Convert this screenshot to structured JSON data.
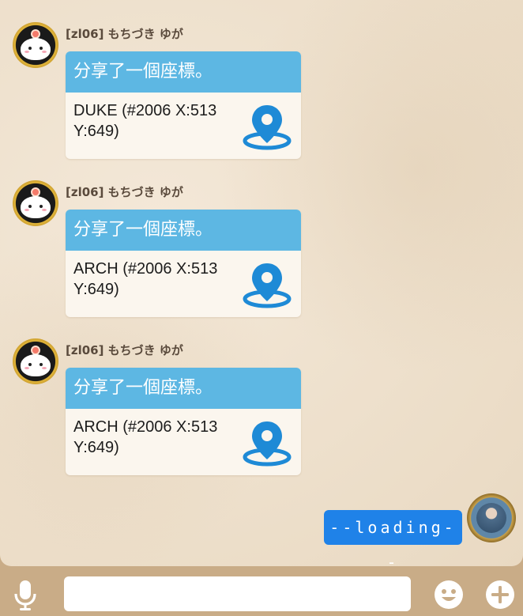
{
  "messages": [
    {
      "sender": "[zl06] もちづき ゆが",
      "card_title": "分享了一個座標。",
      "location": "DUKE (#2006 X:513\nY:649)"
    },
    {
      "sender": "[zl06] もちづき ゆが",
      "card_title": "分享了一個座標。",
      "location": "ARCH (#2006 X:513\nY:649)"
    },
    {
      "sender": "[zl06] もちづき ゆが",
      "card_title": "分享了一個座標。",
      "location": "ARCH (#2006 X:513\nY:649)"
    }
  ],
  "self_message": {
    "text": "--loading--"
  },
  "input_bar": {
    "placeholder": "",
    "icons": [
      "mic-icon",
      "smile-icon",
      "plus-icon"
    ]
  },
  "colors": {
    "card_header": "#5db7e3",
    "pin": "#1e8ad6",
    "self_bubble": "#1f82e8",
    "bar_bg": "#c9ac87"
  }
}
